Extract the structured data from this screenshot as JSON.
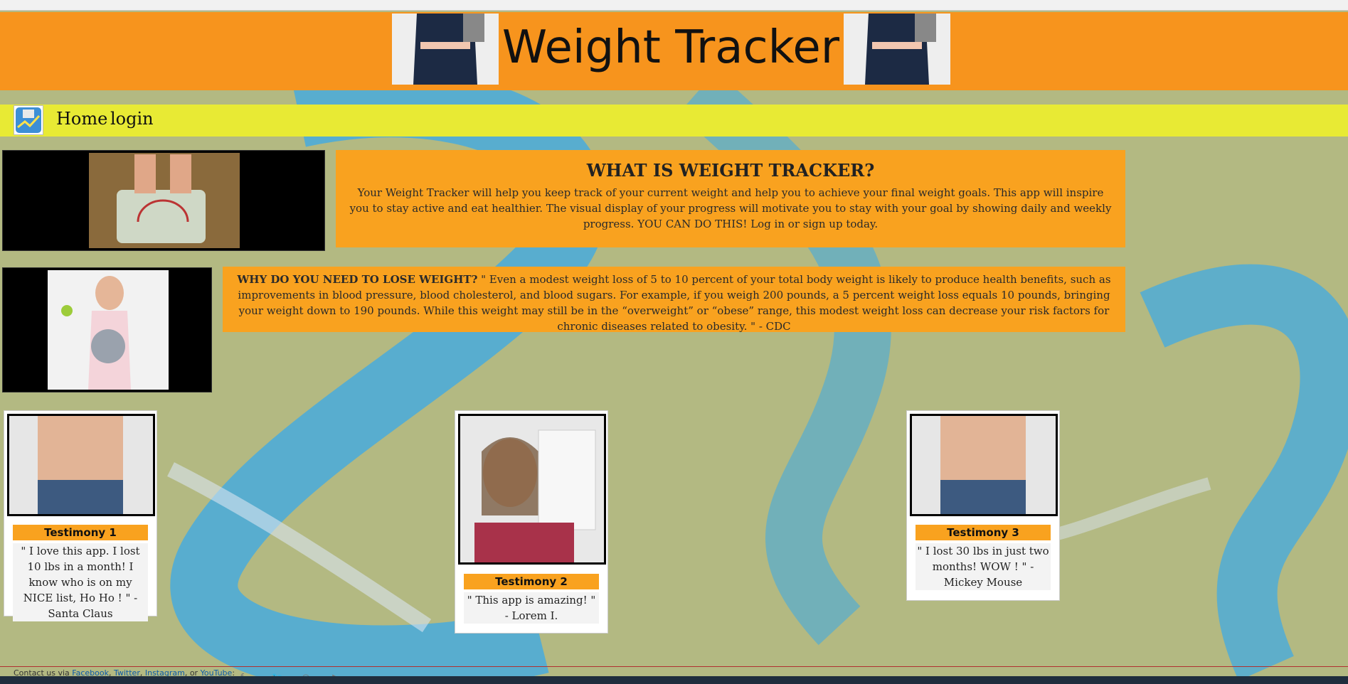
{
  "header": {
    "title": "Weight Tracker"
  },
  "nav": {
    "home_label": "Home",
    "login_label": "login"
  },
  "what": {
    "title": "WHAT IS WEIGHT TRACKER?",
    "text": "Your Weight Tracker will help you keep track of your current weight and help you to achieve your final weight goals. This app will inspire you to stay active and eat healthier. The visual display of your progress will motivate you to stay with your goal by showing daily and weekly progress. YOU CAN DO THIS! Log in or sign up today."
  },
  "why": {
    "title": "WHY DO YOU NEED TO LOSE WEIGHT?",
    "text": " \" Even a modest weight loss of 5 to 10 percent of your total body weight is likely to produce health benefits, such as improvements in blood pressure, blood cholesterol, and blood sugars. For example, if you weigh 200 pounds, a 5 percent weight loss equals 10 pounds, bringing your weight down to 190 pounds. While this weight may still be in the “overweight” or “obese” range, this modest weight loss can decrease your risk factors for chronic diseases related to obesity. \" - CDC"
  },
  "testimonials": [
    {
      "label": "Testimony 1",
      "quote": "\" I love this app. I lost 10 lbs in a month! I know who is on my NICE list, Ho Ho ! \" - Santa Claus"
    },
    {
      "label": "Testimony 2",
      "quote": "\" This app is amazing! \" - Lorem I."
    },
    {
      "label": "Testimony 3",
      "quote": "\" I lost 30 lbs in just two months! WOW ! \" - Mickey Mouse"
    }
  ],
  "footer": {
    "prefix": "Contact us via ",
    "facebook": "Facebook",
    "twitter": "Twitter",
    "instagram": "Instagram",
    "youtube": "YouTube",
    "sep1": ", ",
    "sep2": ", ",
    "sep3": ", or ",
    "suffix": ":"
  },
  "icons": [
    "facebook-icon",
    "twitter-icon",
    "instagram-icon",
    "youtube-icon"
  ],
  "colors": {
    "header": "#f7941d",
    "navbar": "#e8ea34",
    "accent": "#f9a21f",
    "background": "#b3b982",
    "tape": "#3aa9e8"
  }
}
